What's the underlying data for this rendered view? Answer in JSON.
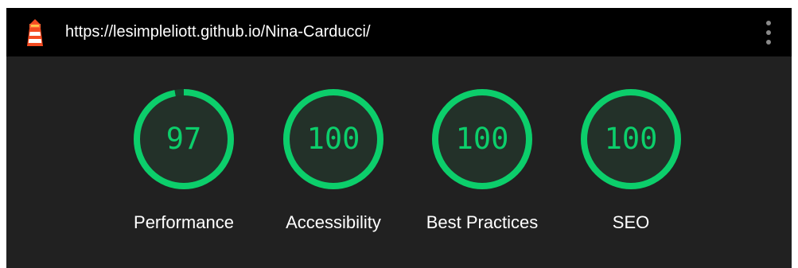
{
  "header": {
    "url": "https://lesimpleliott.github.io/Nina-Carducci/",
    "logo_icon": "lighthouse-icon",
    "menu_icon": "kebab-menu-icon"
  },
  "colors": {
    "pass": "#0cce6b",
    "track": "#1a3d2a",
    "background": "#212121",
    "topbar": "#000000"
  },
  "scores": [
    {
      "value": 97,
      "label": "Performance"
    },
    {
      "value": 100,
      "label": "Accessibility"
    },
    {
      "value": 100,
      "label": "Best Practices"
    },
    {
      "value": 100,
      "label": "SEO"
    }
  ]
}
